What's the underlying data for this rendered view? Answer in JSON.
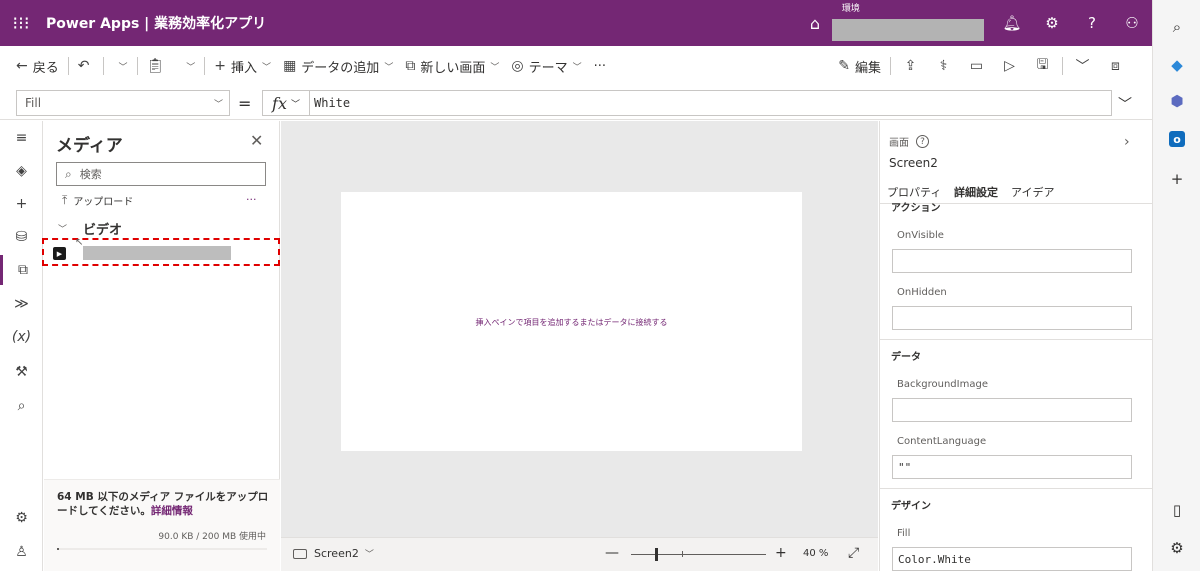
{
  "header": {
    "app_title": "Power Apps | 業務効率化アプリ",
    "env_label": "環境",
    "env_value": ""
  },
  "toolbar": {
    "back": "戻る",
    "insert": "挿入",
    "add_data": "データの追加",
    "new_screen": "新しい画面",
    "theme": "テーマ",
    "more": "···",
    "edit": "編集"
  },
  "formula": {
    "property": "Fill",
    "equals": "=",
    "fx": "fx",
    "value": "White"
  },
  "media_panel": {
    "title": "メディア",
    "search_placeholder": "検索",
    "upload": "アップロード",
    "more": "···",
    "group": "ビデオ",
    "footer_text": "64 MB 以下のメディア ファイルをアップロードしてください。",
    "footer_link": "詳細情報",
    "usage": "90.0 KB / 200 MB 使用中",
    "usage_fraction": 0.00045
  },
  "canvas": {
    "hint": "挿入ペインで項目を追加するまたはデータに接続する"
  },
  "status": {
    "screen": "Screen2",
    "zoom": "40 %",
    "zoom_level": 40
  },
  "properties": {
    "type_label": "画面",
    "name": "Screen2",
    "tabs": [
      "プロパティ",
      "詳細設定",
      "アイデア"
    ],
    "active_tab": 1,
    "section_actions": "アクション",
    "onvisible_label": "OnVisible",
    "onvisible_value": "",
    "onhidden_label": "OnHidden",
    "onhidden_value": "",
    "section_data": "データ",
    "bgimage_label": "BackgroundImage",
    "bgimage_value": "",
    "contentlang_label": "ContentLanguage",
    "contentlang_value": "\"\"",
    "section_design": "デザイン",
    "fill_label": "Fill",
    "fill_value": "Color.White"
  },
  "colors": {
    "brand": "#742774",
    "highlight": "#e00000",
    "canvas_bg": "#e9e9e9"
  }
}
